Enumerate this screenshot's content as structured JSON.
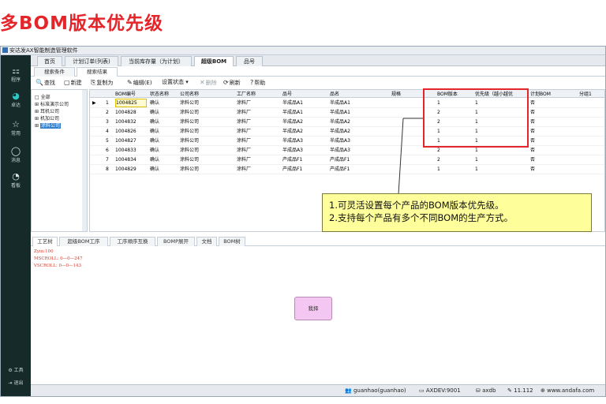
{
  "slide": {
    "title": "多BOM版本优先级"
  },
  "app": {
    "title": "安达发AX智能制造管理软件"
  },
  "nav": [
    {
      "icon": "⚏",
      "label": "程序"
    },
    {
      "icon": "◕",
      "label": "卓达"
    },
    {
      "icon": "☆",
      "label": "常用"
    },
    {
      "icon": "◯",
      "label": "消息"
    },
    {
      "icon": "◔",
      "label": "看板"
    }
  ],
  "nav_bottom": [
    {
      "icon": "⚙",
      "label": "工具"
    },
    {
      "icon": "⇥",
      "label": "退出"
    }
  ],
  "top_tabs": [
    "首页",
    "计划订单(列表)",
    "当前库存量（为计划）",
    "超级BOM",
    "品号"
  ],
  "sub_tabs": [
    "搜索条件",
    "搜索结果"
  ],
  "toolbar": [
    {
      "icon": "🔍",
      "label": "查找",
      "disabled": false
    },
    {
      "icon": "▢",
      "label": "新建",
      "disabled": false
    },
    {
      "icon": "⎘",
      "label": "复制为",
      "disabled": false
    },
    {
      "icon": "✎",
      "label": "编辑(E)",
      "disabled": false
    },
    {
      "icon": "",
      "label": "设置状态 ▾",
      "disabled": false
    },
    {
      "icon": "✕",
      "label": "删除",
      "disabled": true
    },
    {
      "icon": "⟳",
      "label": "刷新",
      "disabled": false
    },
    {
      "icon": "?",
      "label": "帮助",
      "disabled": false
    }
  ],
  "tree": [
    {
      "prefix": "□",
      "label": "全部"
    },
    {
      "prefix": "⊞",
      "label": "标准演示公司"
    },
    {
      "prefix": "⊞",
      "label": "耳机公司"
    },
    {
      "prefix": "⊞",
      "label": "机加公司"
    },
    {
      "prefix": "⊞",
      "label": "涂料公司"
    }
  ],
  "grid": {
    "columns": [
      "BOM编号",
      "状态名称",
      "公司名称",
      "工厂名称",
      "品号",
      "品名",
      "规格",
      "BOM版本",
      "优先级（越小越优",
      "计划BOM",
      "分组1"
    ],
    "rows": [
      {
        "no": "1",
        "code": "1004825",
        "status": "确认",
        "company": "涂料公司",
        "factory": "涂料厂",
        "item": "半成品A1",
        "name": "半成品A1",
        "spec": "",
        "version": "1",
        "priority": "1",
        "plan": "否",
        "group": ""
      },
      {
        "no": "2",
        "code": "1004828",
        "status": "确认",
        "company": "涂料公司",
        "factory": "涂料厂",
        "item": "半成品A1",
        "name": "半成品A1",
        "spec": "",
        "version": "2",
        "priority": "1",
        "plan": "否",
        "group": ""
      },
      {
        "no": "3",
        "code": "1004832",
        "status": "确认",
        "company": "涂料公司",
        "factory": "涂料厂",
        "item": "半成品A2",
        "name": "半成品A2",
        "spec": "",
        "version": "2",
        "priority": "1",
        "plan": "否",
        "group": ""
      },
      {
        "no": "4",
        "code": "1004826",
        "status": "确认",
        "company": "涂料公司",
        "factory": "涂料厂",
        "item": "半成品A2",
        "name": "半成品A2",
        "spec": "",
        "version": "1",
        "priority": "1",
        "plan": "否",
        "group": ""
      },
      {
        "no": "5",
        "code": "1004827",
        "status": "确认",
        "company": "涂料公司",
        "factory": "涂料厂",
        "item": "半成品A3",
        "name": "半成品A3",
        "spec": "",
        "version": "1",
        "priority": "1",
        "plan": "否",
        "group": ""
      },
      {
        "no": "6",
        "code": "1004833",
        "status": "确认",
        "company": "涂料公司",
        "factory": "涂料厂",
        "item": "半成品A3",
        "name": "半成品A3",
        "spec": "",
        "version": "2",
        "priority": "1",
        "plan": "否",
        "group": ""
      },
      {
        "no": "7",
        "code": "1004834",
        "status": "确认",
        "company": "涂料公司",
        "factory": "涂料厂",
        "item": "产成品F1",
        "name": "产成品F1",
        "spec": "",
        "version": "2",
        "priority": "1",
        "plan": "否",
        "group": ""
      },
      {
        "no": "8",
        "code": "1004829",
        "status": "确认",
        "company": "涂料公司",
        "factory": "涂料厂",
        "item": "产成品F1",
        "name": "产成品F1",
        "spec": "",
        "version": "1",
        "priority": "1",
        "plan": "否",
        "group": ""
      }
    ]
  },
  "callout": {
    "line1": "1.可灵活设置每个产品的BOM版本优先级。",
    "line2": "2.支持每个产品有多个不同BOM的生产方式。"
  },
  "bottom_tabs": [
    "工艺树",
    "超级BOM工序",
    "工序顺序互换",
    "BOMP展开",
    "文档",
    "BOM树"
  ],
  "log": [
    "Zyin:100",
    "MSCROLL: 0—0—247",
    "VSCROLL: 0—0—143"
  ],
  "select_button": "我择",
  "status": {
    "user": "guanhao(guanhao)",
    "server": "AXDEV:9001",
    "db": "axdb",
    "version": "11.112",
    "site": "www.andafa.com"
  },
  "colors": {
    "accent_red": "#e4262b",
    "nav_bg": "#162a2a",
    "callout_bg": "#fefe9a"
  }
}
